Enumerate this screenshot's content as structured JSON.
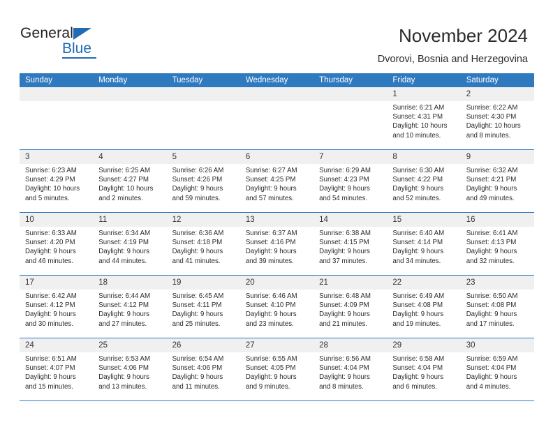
{
  "brand": {
    "name_top": "General",
    "name_bottom": "Blue",
    "accent_color": "#1f6bb5"
  },
  "header": {
    "title": "November 2024",
    "subtitle": "Dvorovi, Bosnia and Herzegovina"
  },
  "calendar": {
    "header_bg": "#2f79bf",
    "daynum_bg": "#f0f0f0",
    "weekday_headers": [
      "Sunday",
      "Monday",
      "Tuesday",
      "Wednesday",
      "Thursday",
      "Friday",
      "Saturday"
    ],
    "weeks": [
      [
        {
          "day": "",
          "lines": []
        },
        {
          "day": "",
          "lines": []
        },
        {
          "day": "",
          "lines": []
        },
        {
          "day": "",
          "lines": []
        },
        {
          "day": "",
          "lines": []
        },
        {
          "day": "1",
          "lines": [
            "Sunrise: 6:21 AM",
            "Sunset: 4:31 PM",
            "Daylight: 10 hours",
            "and 10 minutes."
          ]
        },
        {
          "day": "2",
          "lines": [
            "Sunrise: 6:22 AM",
            "Sunset: 4:30 PM",
            "Daylight: 10 hours",
            "and 8 minutes."
          ]
        }
      ],
      [
        {
          "day": "3",
          "lines": [
            "Sunrise: 6:23 AM",
            "Sunset: 4:29 PM",
            "Daylight: 10 hours",
            "and 5 minutes."
          ]
        },
        {
          "day": "4",
          "lines": [
            "Sunrise: 6:25 AM",
            "Sunset: 4:27 PM",
            "Daylight: 10 hours",
            "and 2 minutes."
          ]
        },
        {
          "day": "5",
          "lines": [
            "Sunrise: 6:26 AM",
            "Sunset: 4:26 PM",
            "Daylight: 9 hours",
            "and 59 minutes."
          ]
        },
        {
          "day": "6",
          "lines": [
            "Sunrise: 6:27 AM",
            "Sunset: 4:25 PM",
            "Daylight: 9 hours",
            "and 57 minutes."
          ]
        },
        {
          "day": "7",
          "lines": [
            "Sunrise: 6:29 AM",
            "Sunset: 4:23 PM",
            "Daylight: 9 hours",
            "and 54 minutes."
          ]
        },
        {
          "day": "8",
          "lines": [
            "Sunrise: 6:30 AM",
            "Sunset: 4:22 PM",
            "Daylight: 9 hours",
            "and 52 minutes."
          ]
        },
        {
          "day": "9",
          "lines": [
            "Sunrise: 6:32 AM",
            "Sunset: 4:21 PM",
            "Daylight: 9 hours",
            "and 49 minutes."
          ]
        }
      ],
      [
        {
          "day": "10",
          "lines": [
            "Sunrise: 6:33 AM",
            "Sunset: 4:20 PM",
            "Daylight: 9 hours",
            "and 46 minutes."
          ]
        },
        {
          "day": "11",
          "lines": [
            "Sunrise: 6:34 AM",
            "Sunset: 4:19 PM",
            "Daylight: 9 hours",
            "and 44 minutes."
          ]
        },
        {
          "day": "12",
          "lines": [
            "Sunrise: 6:36 AM",
            "Sunset: 4:18 PM",
            "Daylight: 9 hours",
            "and 41 minutes."
          ]
        },
        {
          "day": "13",
          "lines": [
            "Sunrise: 6:37 AM",
            "Sunset: 4:16 PM",
            "Daylight: 9 hours",
            "and 39 minutes."
          ]
        },
        {
          "day": "14",
          "lines": [
            "Sunrise: 6:38 AM",
            "Sunset: 4:15 PM",
            "Daylight: 9 hours",
            "and 37 minutes."
          ]
        },
        {
          "day": "15",
          "lines": [
            "Sunrise: 6:40 AM",
            "Sunset: 4:14 PM",
            "Daylight: 9 hours",
            "and 34 minutes."
          ]
        },
        {
          "day": "16",
          "lines": [
            "Sunrise: 6:41 AM",
            "Sunset: 4:13 PM",
            "Daylight: 9 hours",
            "and 32 minutes."
          ]
        }
      ],
      [
        {
          "day": "17",
          "lines": [
            "Sunrise: 6:42 AM",
            "Sunset: 4:12 PM",
            "Daylight: 9 hours",
            "and 30 minutes."
          ]
        },
        {
          "day": "18",
          "lines": [
            "Sunrise: 6:44 AM",
            "Sunset: 4:12 PM",
            "Daylight: 9 hours",
            "and 27 minutes."
          ]
        },
        {
          "day": "19",
          "lines": [
            "Sunrise: 6:45 AM",
            "Sunset: 4:11 PM",
            "Daylight: 9 hours",
            "and 25 minutes."
          ]
        },
        {
          "day": "20",
          "lines": [
            "Sunrise: 6:46 AM",
            "Sunset: 4:10 PM",
            "Daylight: 9 hours",
            "and 23 minutes."
          ]
        },
        {
          "day": "21",
          "lines": [
            "Sunrise: 6:48 AM",
            "Sunset: 4:09 PM",
            "Daylight: 9 hours",
            "and 21 minutes."
          ]
        },
        {
          "day": "22",
          "lines": [
            "Sunrise: 6:49 AM",
            "Sunset: 4:08 PM",
            "Daylight: 9 hours",
            "and 19 minutes."
          ]
        },
        {
          "day": "23",
          "lines": [
            "Sunrise: 6:50 AM",
            "Sunset: 4:08 PM",
            "Daylight: 9 hours",
            "and 17 minutes."
          ]
        }
      ],
      [
        {
          "day": "24",
          "lines": [
            "Sunrise: 6:51 AM",
            "Sunset: 4:07 PM",
            "Daylight: 9 hours",
            "and 15 minutes."
          ]
        },
        {
          "day": "25",
          "lines": [
            "Sunrise: 6:53 AM",
            "Sunset: 4:06 PM",
            "Daylight: 9 hours",
            "and 13 minutes."
          ]
        },
        {
          "day": "26",
          "lines": [
            "Sunrise: 6:54 AM",
            "Sunset: 4:06 PM",
            "Daylight: 9 hours",
            "and 11 minutes."
          ]
        },
        {
          "day": "27",
          "lines": [
            "Sunrise: 6:55 AM",
            "Sunset: 4:05 PM",
            "Daylight: 9 hours",
            "and 9 minutes."
          ]
        },
        {
          "day": "28",
          "lines": [
            "Sunrise: 6:56 AM",
            "Sunset: 4:04 PM",
            "Daylight: 9 hours",
            "and 8 minutes."
          ]
        },
        {
          "day": "29",
          "lines": [
            "Sunrise: 6:58 AM",
            "Sunset: 4:04 PM",
            "Daylight: 9 hours",
            "and 6 minutes."
          ]
        },
        {
          "day": "30",
          "lines": [
            "Sunrise: 6:59 AM",
            "Sunset: 4:04 PM",
            "Daylight: 9 hours",
            "and 4 minutes."
          ]
        }
      ]
    ]
  }
}
